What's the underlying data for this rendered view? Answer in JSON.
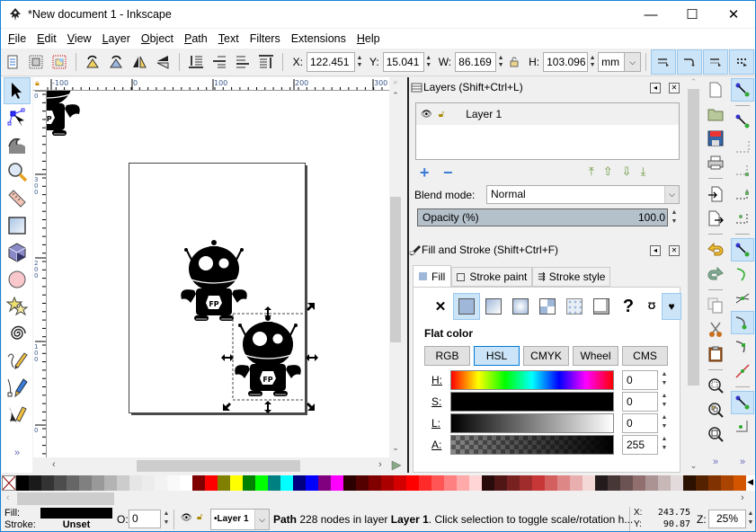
{
  "window": {
    "title": "*New document 1 - Inkscape",
    "controls": {
      "minimize": "—",
      "maximize": "☐",
      "close": "✕"
    }
  },
  "menu": [
    {
      "label": "File",
      "u": "F",
      "rest": "ile"
    },
    {
      "label": "Edit",
      "u": "E",
      "rest": "dit"
    },
    {
      "label": "View",
      "u": "V",
      "rest": "iew"
    },
    {
      "label": "Layer",
      "u": "L",
      "rest": "ayer"
    },
    {
      "label": "Object",
      "u": "O",
      "rest": "bject"
    },
    {
      "label": "Path",
      "u": "P",
      "rest": "ath"
    },
    {
      "label": "Text",
      "u": "T",
      "rest": "ext"
    },
    {
      "label": "Filters",
      "u": "",
      "rest": "Filters"
    },
    {
      "label": "Extensions",
      "u": "",
      "rest": "Extensions"
    },
    {
      "label": "Help",
      "u": "H",
      "rest": "elp"
    }
  ],
  "toolbar": {
    "x_label": "X:",
    "x_value": "122.451",
    "y_label": "Y:",
    "y_value": "15.041",
    "w_label": "W:",
    "w_value": "86.169",
    "h_label": "H:",
    "h_value": "103.096",
    "unit": "mm"
  },
  "rulers": {
    "horizontal": [
      "-100",
      "0",
      "100",
      "200",
      "300"
    ],
    "vertical": [
      "0",
      "300",
      "200",
      "100",
      "0"
    ]
  },
  "layers_panel": {
    "title": "Layers (Shift+Ctrl+L)",
    "layers": [
      {
        "name": "Layer 1",
        "visible": true,
        "locked": false
      }
    ],
    "blend_label": "Blend mode:",
    "blend_value": "Normal",
    "opacity_label": "Opacity (%)",
    "opacity_value": "100.0"
  },
  "fill_stroke_panel": {
    "title": "Fill and Stroke (Shift+Ctrl+F)",
    "tabs": [
      {
        "label": "Fill",
        "active": true
      },
      {
        "label": "Stroke paint",
        "active": false
      },
      {
        "label": "Stroke style",
        "active": false
      }
    ],
    "paint_types": [
      "no-paint",
      "flat-color",
      "linear-gradient",
      "radial-gradient",
      "mesh",
      "pattern",
      "swatch",
      "unset",
      "fill-rule-evenodd",
      "fill-rule-nonzero"
    ],
    "mode_label": "Flat color",
    "color_modes": [
      {
        "label": "RGB",
        "active": false
      },
      {
        "label": "HSL",
        "active": true
      },
      {
        "label": "CMYK",
        "active": false
      },
      {
        "label": "Wheel",
        "active": false
      },
      {
        "label": "CMS",
        "active": false
      }
    ],
    "channels": [
      {
        "label": "H:",
        "value": "0"
      },
      {
        "label": "S:",
        "value": "0"
      },
      {
        "label": "L:",
        "value": "0"
      },
      {
        "label": "A:",
        "value": "255"
      }
    ]
  },
  "palette": [
    "#000000",
    "#1a1a1a",
    "#333333",
    "#4d4d4d",
    "#666666",
    "#808080",
    "#999999",
    "#b3b3b3",
    "#cccccc",
    "#e6e6e6",
    "#ececec",
    "#f2f2f2",
    "#f9f9f9",
    "#ffffff",
    "#800000",
    "#ff0000",
    "#808000",
    "#ffff00",
    "#008000",
    "#00ff00",
    "#008080",
    "#00ffff",
    "#000080",
    "#0000ff",
    "#800080",
    "#ff00ff",
    "#2b0000",
    "#550000",
    "#800000",
    "#aa0000",
    "#d40000",
    "#ff0000",
    "#ff2a2a",
    "#ff5555",
    "#ff8080",
    "#ffaaaa",
    "#ffd5d5",
    "#280b0b",
    "#501616",
    "#782121",
    "#a02c2c",
    "#c83737",
    "#d35f5f",
    "#de8787",
    "#e9afaf",
    "#f4d7d7",
    "#241c1c",
    "#483737",
    "#6c5353",
    "#916f6f",
    "#ac9393",
    "#c8b7b7",
    "#e3dbdb",
    "#2b1100",
    "#552200",
    "#803300",
    "#aa4400",
    "#d45500"
  ],
  "status": {
    "fill_label": "Fill:",
    "stroke_label": "Stroke:",
    "stroke_value": "Unset",
    "fill_color": "#000000",
    "opacity_label": "O:",
    "opacity_value": "0",
    "layer_value": "•Layer 1",
    "message_bold1": "Path",
    "message_mid": " 228 nodes in layer ",
    "message_bold2": "Layer 1",
    "message_end": ". Click selection to toggle scale/rotation h...",
    "cursor_x_label": "X:",
    "cursor_x": "243.75",
    "cursor_y_label": "Y:",
    "cursor_y": "90.87",
    "zoom_label": "Z:",
    "zoom_value": "25%"
  },
  "colors": {
    "accent": "#0078d7",
    "selected_bg": "#cce4f7",
    "selected_border": "#99c9ef",
    "flat_color_swatch": "#9fb8d9"
  }
}
